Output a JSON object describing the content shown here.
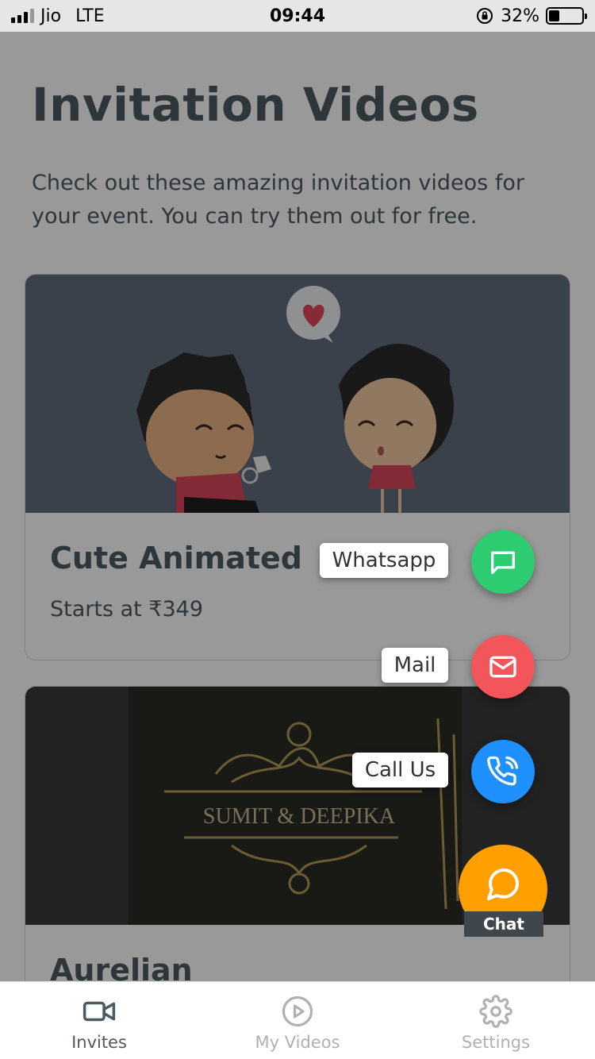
{
  "status_bar": {
    "carrier": "Jio",
    "network": "LTE",
    "time": "09:44",
    "battery": "32%",
    "battery_level": 0.32
  },
  "page": {
    "title": "Invitation Videos",
    "description": "Check out these amazing invitation videos for your event. You can try them out for free."
  },
  "cards": [
    {
      "title": "Cute Animated",
      "price": "Starts at ₹349"
    },
    {
      "title": "Aurelian",
      "thumbnail_text": "SUMIT & DEEPIKA"
    }
  ],
  "fab_menu": {
    "items": [
      {
        "label": "Whatsapp",
        "icon": "message-square-icon",
        "color": "#2ecc71"
      },
      {
        "label": "Mail",
        "icon": "mail-icon",
        "color": "#f2555a"
      },
      {
        "label": "Call Us",
        "icon": "phone-call-icon",
        "color": "#1e90ff"
      }
    ],
    "main": {
      "label": "Chat",
      "icon": "chat-bubble-icon",
      "color": "#ffa000"
    }
  },
  "tabs": [
    {
      "label": "Invites",
      "icon": "video-camera-icon",
      "active": true
    },
    {
      "label": "My Videos",
      "icon": "play-circle-icon",
      "active": false
    },
    {
      "label": "Settings",
      "icon": "gear-icon",
      "active": false
    }
  ]
}
